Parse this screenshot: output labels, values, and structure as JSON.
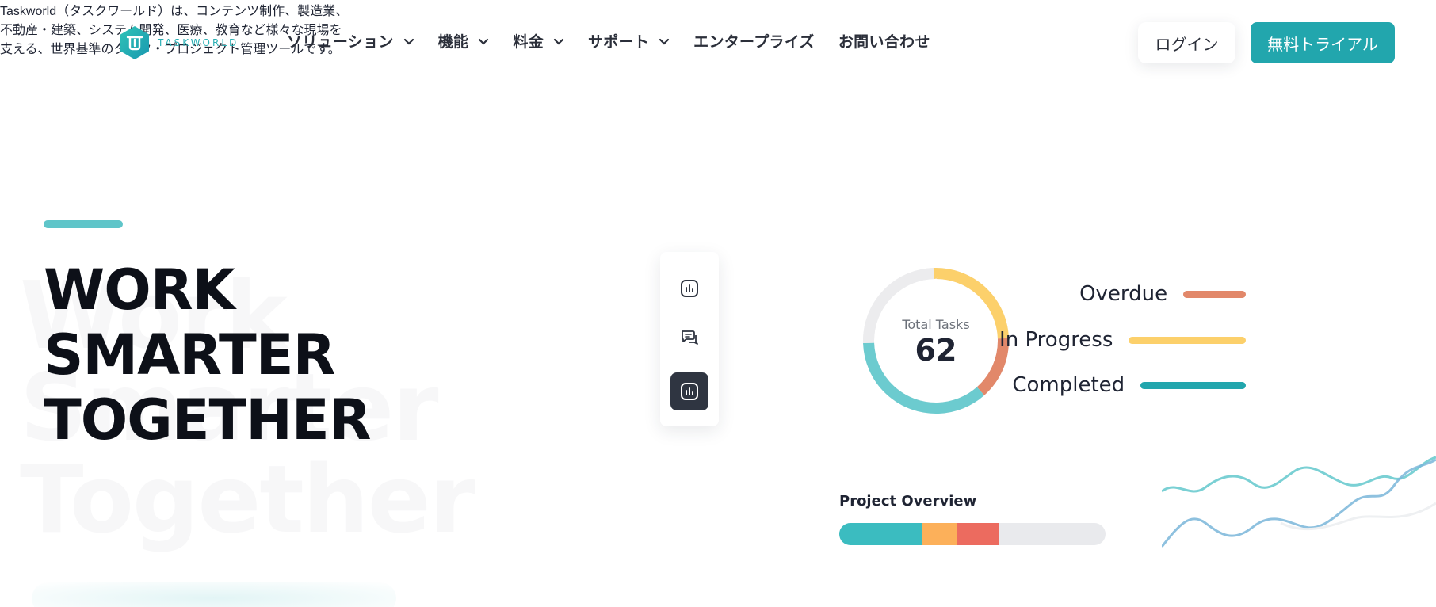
{
  "brand": {
    "name": "TASKWORLD",
    "tm": "™",
    "color": "#22a6ad"
  },
  "nav": {
    "items": [
      {
        "label": "ソリューション",
        "has_dropdown": true
      },
      {
        "label": "機能",
        "has_dropdown": true
      },
      {
        "label": "料金",
        "has_dropdown": true
      },
      {
        "label": "サポート",
        "has_dropdown": true
      },
      {
        "label": "エンタープライズ",
        "has_dropdown": false
      },
      {
        "label": "お問い合わせ",
        "has_dropdown": false
      }
    ],
    "login_label": "ログイン",
    "trial_label": "無料トライアル"
  },
  "hero": {
    "headline": [
      "WORK",
      "SMARTER",
      "TOGETHER"
    ],
    "watermark": [
      "Work",
      "Smarter",
      "Together"
    ],
    "description": [
      "Taskworld（タスクワールド）は、コンテンツ制作、製造業、",
      "不動産・建築、システム開発、医療、教育など様々な現場を",
      "支える、世界基準のタスク・プロジェクト管理ツールです。"
    ]
  },
  "rail": {
    "items": [
      {
        "icon": "bar-chart-icon",
        "active": false
      },
      {
        "icon": "chat-bubbles-icon",
        "active": false
      },
      {
        "icon": "bar-chart-icon",
        "active": true
      }
    ]
  },
  "dashboard": {
    "total_tasks_label": "Total Tasks",
    "total_tasks_value": "62",
    "donut_segments": [
      {
        "name": "In Progress",
        "fraction": 0.25,
        "color": "#fcd06b"
      },
      {
        "name": "Overdue",
        "fraction": 0.14,
        "color": "#e2886a"
      },
      {
        "name": "Completed",
        "fraction": 0.36,
        "color": "#6ccbcf"
      },
      {
        "name": "Remaining",
        "fraction": 0.25,
        "color": "#ececee"
      }
    ],
    "legend": [
      {
        "label": "Overdue",
        "color": "#e2886a",
        "bar_fraction": 0.42
      },
      {
        "label": "In Progress",
        "color": "#fcd06b",
        "bar_fraction": 1.0
      },
      {
        "label": "Completed",
        "color": "#22a6ad",
        "bar_fraction": 0.85
      }
    ],
    "project_overview": {
      "title": "Project Overview",
      "segments": [
        {
          "fraction": 0.31,
          "color": "#3bbcc0"
        },
        {
          "fraction": 0.13,
          "color": "#fcb05a"
        },
        {
          "fraction": 0.16,
          "color": "#ec6b5f"
        }
      ]
    }
  }
}
